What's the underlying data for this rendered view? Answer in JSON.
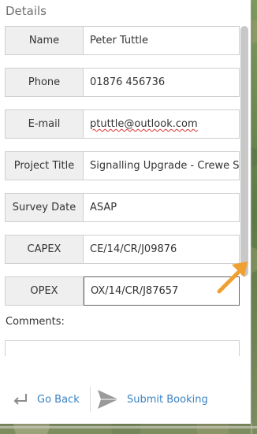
{
  "panel": {
    "title": "Details"
  },
  "form": {
    "fields": [
      {
        "label": "Name",
        "value": "Peter Tuttle"
      },
      {
        "label": "Phone",
        "value": "01876 456736"
      },
      {
        "label": "E-mail",
        "value": "ptuttle@outlook.com"
      },
      {
        "label": "Project Title",
        "value": "Signalling Upgrade - Crewe Se"
      },
      {
        "label": "Survey Date",
        "value": "ASAP"
      },
      {
        "label": "CAPEX",
        "value": "CE/14/CR/J09876"
      },
      {
        "label": "OPEX",
        "value": "OX/14/CR/J87657"
      }
    ],
    "comments_label": "Comments:",
    "comments_value": ""
  },
  "footer": {
    "back_label": "Go Back",
    "submit_label": "Submit Booking"
  },
  "colors": {
    "link": "#3b82c4",
    "arrow": "#f0a030"
  },
  "icons": [
    "return-arrow-icon",
    "send-icon",
    "pointer-arrow-icon"
  ]
}
